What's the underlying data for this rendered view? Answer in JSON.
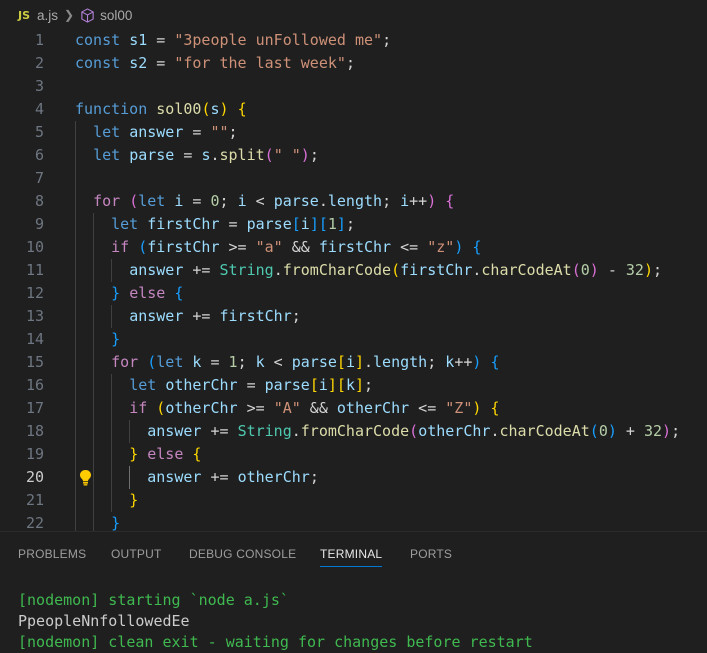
{
  "breadcrumb": {
    "badge": "JS",
    "file": "a.js",
    "symbol": "sol00"
  },
  "editor": {
    "active_line": 20,
    "lines": [
      {
        "n": "1",
        "tokens": [
          [
            "kw",
            "const "
          ],
          [
            "var",
            "s1"
          ],
          [
            "op",
            " = "
          ],
          [
            "str",
            "\"3people unFollowed me\""
          ],
          [
            "op",
            ";"
          ]
        ]
      },
      {
        "n": "2",
        "tokens": [
          [
            "kw",
            "const "
          ],
          [
            "var",
            "s2"
          ],
          [
            "op",
            " = "
          ],
          [
            "str",
            "\"for the last week\""
          ],
          [
            "op",
            ";"
          ]
        ]
      },
      {
        "n": "3",
        "tokens": []
      },
      {
        "n": "4",
        "tokens": [
          [
            "kw",
            "function "
          ],
          [
            "fn",
            "sol00"
          ],
          [
            "p1",
            "("
          ],
          [
            "var",
            "s"
          ],
          [
            "p1",
            ")"
          ],
          [
            "op",
            " "
          ],
          [
            "p1",
            "{"
          ]
        ]
      },
      {
        "n": "5",
        "tokens": [
          [
            "op",
            "  "
          ],
          [
            "kw",
            "let "
          ],
          [
            "var",
            "answer"
          ],
          [
            "op",
            " = "
          ],
          [
            "str",
            "\"\""
          ],
          [
            "op",
            ";"
          ]
        ]
      },
      {
        "n": "6",
        "tokens": [
          [
            "op",
            "  "
          ],
          [
            "kw",
            "let "
          ],
          [
            "var",
            "parse"
          ],
          [
            "op",
            " = "
          ],
          [
            "var",
            "s"
          ],
          [
            "op",
            "."
          ],
          [
            "fn",
            "split"
          ],
          [
            "p2",
            "("
          ],
          [
            "str",
            "\" \""
          ],
          [
            "p2",
            ")"
          ],
          [
            "op",
            ";"
          ]
        ]
      },
      {
        "n": "7",
        "tokens": []
      },
      {
        "n": "8",
        "tokens": [
          [
            "op",
            "  "
          ],
          [
            "ctl",
            "for"
          ],
          [
            "op",
            " "
          ],
          [
            "p2",
            "("
          ],
          [
            "kw",
            "let "
          ],
          [
            "var",
            "i"
          ],
          [
            "op",
            " = "
          ],
          [
            "num",
            "0"
          ],
          [
            "op",
            "; "
          ],
          [
            "var",
            "i"
          ],
          [
            "op",
            " < "
          ],
          [
            "var",
            "parse"
          ],
          [
            "op",
            "."
          ],
          [
            "var",
            "length"
          ],
          [
            "op",
            "; "
          ],
          [
            "var",
            "i"
          ],
          [
            "op",
            "++"
          ],
          [
            "p2",
            ")"
          ],
          [
            "op",
            " "
          ],
          [
            "p2",
            "{"
          ]
        ]
      },
      {
        "n": "9",
        "tokens": [
          [
            "op",
            "    "
          ],
          [
            "kw",
            "let "
          ],
          [
            "var",
            "firstChr"
          ],
          [
            "op",
            " = "
          ],
          [
            "var",
            "parse"
          ],
          [
            "p3",
            "["
          ],
          [
            "var",
            "i"
          ],
          [
            "p3",
            "]"
          ],
          [
            "p3",
            "["
          ],
          [
            "num",
            "1"
          ],
          [
            "p3",
            "]"
          ],
          [
            "op",
            ";"
          ]
        ]
      },
      {
        "n": "10",
        "tokens": [
          [
            "op",
            "    "
          ],
          [
            "ctl",
            "if"
          ],
          [
            "op",
            " "
          ],
          [
            "p3",
            "("
          ],
          [
            "var",
            "firstChr"
          ],
          [
            "op",
            " >= "
          ],
          [
            "str",
            "\"a\""
          ],
          [
            "op",
            " && "
          ],
          [
            "var",
            "firstChr"
          ],
          [
            "op",
            " <= "
          ],
          [
            "str",
            "\"z\""
          ],
          [
            "p3",
            ")"
          ],
          [
            "op",
            " "
          ],
          [
            "p3",
            "{"
          ]
        ]
      },
      {
        "n": "11",
        "tokens": [
          [
            "op",
            "      "
          ],
          [
            "var",
            "answer"
          ],
          [
            "op",
            " += "
          ],
          [
            "cls",
            "String"
          ],
          [
            "op",
            "."
          ],
          [
            "fn",
            "fromCharCode"
          ],
          [
            "p1",
            "("
          ],
          [
            "var",
            "firstChr"
          ],
          [
            "op",
            "."
          ],
          [
            "fn",
            "charCodeAt"
          ],
          [
            "p2",
            "("
          ],
          [
            "num",
            "0"
          ],
          [
            "p2",
            ")"
          ],
          [
            "op",
            " - "
          ],
          [
            "num",
            "32"
          ],
          [
            "p1",
            ")"
          ],
          [
            "op",
            ";"
          ]
        ]
      },
      {
        "n": "12",
        "tokens": [
          [
            "op",
            "    "
          ],
          [
            "p3",
            "}"
          ],
          [
            "op",
            " "
          ],
          [
            "ctl",
            "else"
          ],
          [
            "op",
            " "
          ],
          [
            "p3",
            "{"
          ]
        ]
      },
      {
        "n": "13",
        "tokens": [
          [
            "op",
            "      "
          ],
          [
            "var",
            "answer"
          ],
          [
            "op",
            " += "
          ],
          [
            "var",
            "firstChr"
          ],
          [
            "op",
            ";"
          ]
        ]
      },
      {
        "n": "14",
        "tokens": [
          [
            "op",
            "    "
          ],
          [
            "p3",
            "}"
          ]
        ]
      },
      {
        "n": "15",
        "tokens": [
          [
            "op",
            "    "
          ],
          [
            "ctl",
            "for"
          ],
          [
            "op",
            " "
          ],
          [
            "p3",
            "("
          ],
          [
            "kw",
            "let "
          ],
          [
            "var",
            "k"
          ],
          [
            "op",
            " = "
          ],
          [
            "num",
            "1"
          ],
          [
            "op",
            "; "
          ],
          [
            "var",
            "k"
          ],
          [
            "op",
            " < "
          ],
          [
            "var",
            "parse"
          ],
          [
            "p1",
            "["
          ],
          [
            "var",
            "i"
          ],
          [
            "p1",
            "]"
          ],
          [
            "op",
            "."
          ],
          [
            "var",
            "length"
          ],
          [
            "op",
            "; "
          ],
          [
            "var",
            "k"
          ],
          [
            "op",
            "++"
          ],
          [
            "p3",
            ")"
          ],
          [
            "op",
            " "
          ],
          [
            "p3",
            "{"
          ]
        ]
      },
      {
        "n": "16",
        "tokens": [
          [
            "op",
            "      "
          ],
          [
            "kw",
            "let "
          ],
          [
            "var",
            "otherChr"
          ],
          [
            "op",
            " = "
          ],
          [
            "var",
            "parse"
          ],
          [
            "p1",
            "["
          ],
          [
            "var",
            "i"
          ],
          [
            "p1",
            "]"
          ],
          [
            "p1",
            "["
          ],
          [
            "var",
            "k"
          ],
          [
            "p1",
            "]"
          ],
          [
            "op",
            ";"
          ]
        ]
      },
      {
        "n": "17",
        "tokens": [
          [
            "op",
            "      "
          ],
          [
            "ctl",
            "if"
          ],
          [
            "op",
            " "
          ],
          [
            "p1",
            "("
          ],
          [
            "var",
            "otherChr"
          ],
          [
            "op",
            " >= "
          ],
          [
            "str",
            "\"A\""
          ],
          [
            "op",
            " && "
          ],
          [
            "var",
            "otherChr"
          ],
          [
            "op",
            " <= "
          ],
          [
            "str",
            "\"Z\""
          ],
          [
            "p1",
            ")"
          ],
          [
            "op",
            " "
          ],
          [
            "p1",
            "{"
          ]
        ]
      },
      {
        "n": "18",
        "tokens": [
          [
            "op",
            "        "
          ],
          [
            "var",
            "answer"
          ],
          [
            "op",
            " += "
          ],
          [
            "cls",
            "String"
          ],
          [
            "op",
            "."
          ],
          [
            "fn",
            "fromCharCode"
          ],
          [
            "p2",
            "("
          ],
          [
            "var",
            "otherChr"
          ],
          [
            "op",
            "."
          ],
          [
            "fn",
            "charCodeAt"
          ],
          [
            "p3",
            "("
          ],
          [
            "num",
            "0"
          ],
          [
            "p3",
            ")"
          ],
          [
            "op",
            " + "
          ],
          [
            "num",
            "32"
          ],
          [
            "p2",
            ")"
          ],
          [
            "op",
            ";"
          ]
        ]
      },
      {
        "n": "19",
        "tokens": [
          [
            "op",
            "      "
          ],
          [
            "p1",
            "}"
          ],
          [
            "op",
            " "
          ],
          [
            "ctl",
            "else"
          ],
          [
            "op",
            " "
          ],
          [
            "p1",
            "{"
          ]
        ]
      },
      {
        "n": "20",
        "tokens": [
          [
            "op",
            "        "
          ],
          [
            "var",
            "answer"
          ],
          [
            "op",
            " += "
          ],
          [
            "var",
            "otherChr"
          ],
          [
            "op",
            ";"
          ]
        ]
      },
      {
        "n": "21",
        "tokens": [
          [
            "op",
            "      "
          ],
          [
            "p1",
            "}"
          ]
        ]
      },
      {
        "n": "22",
        "tokens": [
          [
            "op",
            "    "
          ],
          [
            "p3",
            "}"
          ]
        ]
      }
    ]
  },
  "panel": {
    "tabs": [
      "PROBLEMS",
      "OUTPUT",
      "DEBUG CONSOLE",
      "TERMINAL",
      "PORTS"
    ],
    "active_tab": "TERMINAL"
  },
  "terminal": {
    "lines": [
      {
        "text": "[nodemon] starting `node a.js`",
        "color": "green"
      },
      {
        "text": "PpeopleNnfollowedEe",
        "color": "white"
      },
      {
        "text": "[nodemon] clean exit - waiting for changes before restart",
        "color": "green"
      }
    ]
  },
  "colors": {
    "background": "#1f1f1f",
    "keyword": "#569cd6",
    "control": "#c586c0",
    "string": "#ce9178",
    "tab_accent": "#0078d4",
    "terminal_green": "#3fb950"
  }
}
